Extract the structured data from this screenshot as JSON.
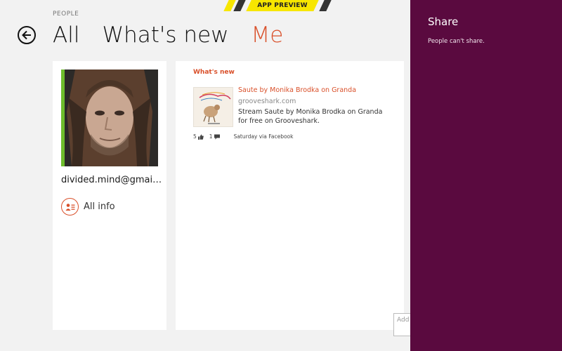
{
  "banner": {
    "label": "APP PREVIEW"
  },
  "app": {
    "section_label": "PEOPLE"
  },
  "pivot": {
    "tabs": [
      {
        "label": "All"
      },
      {
        "label": "What's new"
      },
      {
        "label": "Me"
      }
    ],
    "active_index": 2
  },
  "profile": {
    "email": "divided.mind@gmail.com",
    "all_info_label": "All info"
  },
  "whats_new": {
    "title": "What's new",
    "post": {
      "link_title": "Saute by Monika Brodka on Granda",
      "domain": "grooveshark.com",
      "description": "Stream Saute by Monika Brodka on Granda for free on Grooveshark.",
      "likes": "5",
      "comments": "1",
      "source": "Saturday via Facebook"
    }
  },
  "add_box": {
    "placeholder": "Add"
  },
  "share": {
    "title": "Share",
    "message": "People can't share."
  },
  "colors": {
    "accent": "#d9502a",
    "share_pane": "#5a0a3f",
    "banner": "#f7e600",
    "photo_accent": "#6dbd2c"
  }
}
